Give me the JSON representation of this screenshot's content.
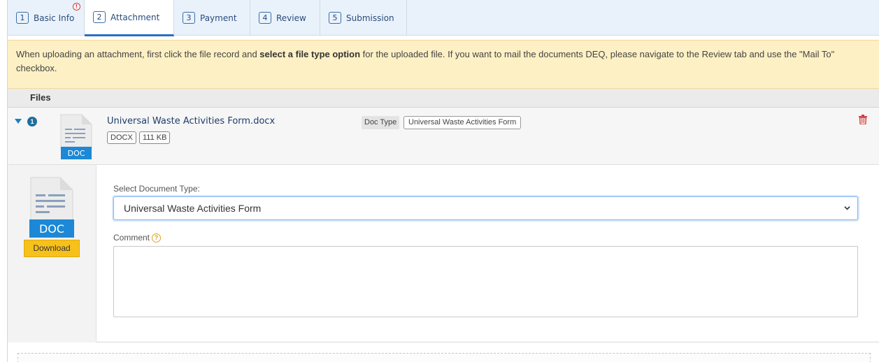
{
  "tabs": [
    {
      "num": "1",
      "label": "Basic Info",
      "alert": "!"
    },
    {
      "num": "2",
      "label": "Attachment"
    },
    {
      "num": "3",
      "label": "Payment"
    },
    {
      "num": "4",
      "label": "Review"
    },
    {
      "num": "5",
      "label": "Submission"
    }
  ],
  "notice": {
    "part1": "When uploading an attachment, first click the file record and ",
    "bold": "select a file type option",
    "part2": " for the uploaded file. If you want to mail the documents DEQ, please navigate to the Review tab and use the \"Mail To\" checkbox."
  },
  "files_header": "Files",
  "file": {
    "count": "1",
    "name": "Universal Waste Activities Form.docx",
    "ext": "DOCX",
    "size": "111 KB",
    "doctype_label": "Doc Type",
    "doctype_value": "Universal Waste Activities Form",
    "icon_text": "DOC"
  },
  "detail": {
    "icon_text": "DOC",
    "download_label": "Download",
    "select_label": "Select Document Type:",
    "select_value": "Universal Waste Activities Form",
    "comment_label": "Comment",
    "help_glyph": "?",
    "comment_value": ""
  },
  "colors": {
    "accent": "#2d6fc1",
    "warning_bg": "#fdf0c4",
    "download_btn": "#f7c11c",
    "delete": "#d23a3a"
  },
  "icons": [
    "caret-down-icon",
    "trash-icon",
    "doc-file-icon",
    "chevron-down-icon",
    "help-icon",
    "alert-icon"
  ]
}
